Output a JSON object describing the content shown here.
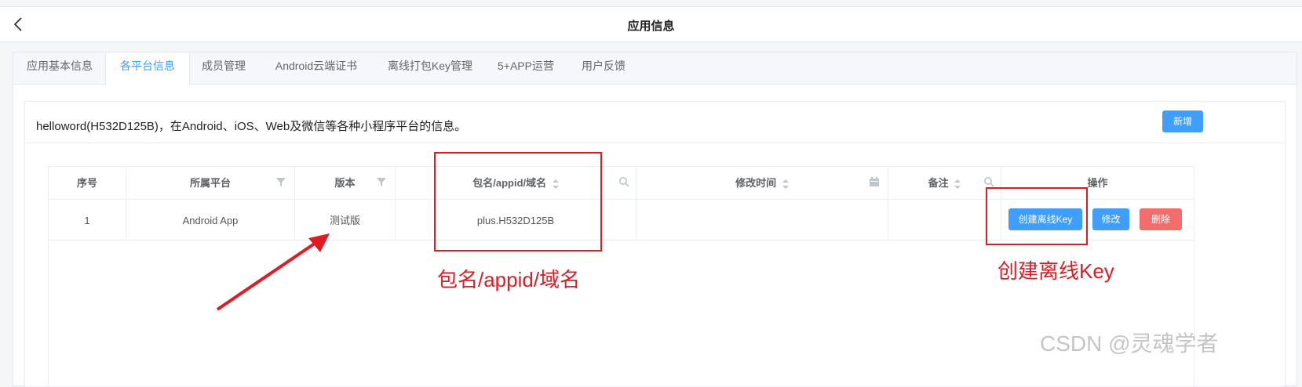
{
  "header": {
    "title": "应用信息",
    "back_icon": "chevron-left-icon"
  },
  "tabs": [
    {
      "label": "应用基本信息",
      "active": false
    },
    {
      "label": "各平台信息",
      "active": true
    },
    {
      "label": "成员管理",
      "active": false
    },
    {
      "label": "Android云端证书",
      "active": false
    },
    {
      "label": "离线打包Key管理",
      "active": false
    },
    {
      "label": "5+APP运营",
      "active": false
    },
    {
      "label": "用户反馈",
      "active": false
    }
  ],
  "card": {
    "description": "helloword(H532D125B)，在Android、iOS、Web及微信等各种小程序平台的信息。",
    "add_button": "新增"
  },
  "table": {
    "columns": [
      "序号",
      "所属平台",
      "版本",
      "包名/appid/域名",
      "修改时间",
      "备注",
      "操作"
    ],
    "rows": [
      {
        "index": "1",
        "platform": "Android App",
        "version": "测试版",
        "package": "plus.H532D125B",
        "modified": "",
        "note": "",
        "actions": [
          "创建离线Key",
          "修改",
          "删除"
        ]
      }
    ]
  },
  "annotations": {
    "package_label": "包名/appid/域名",
    "create_key_label": "创建离线Key"
  },
  "watermark": "CSDN @灵魂学者",
  "colors": {
    "accent": "#409eff",
    "danger": "#f56c6c",
    "annotation": "#e01b24"
  }
}
